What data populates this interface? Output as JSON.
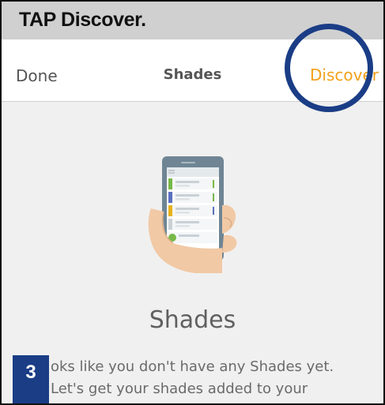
{
  "banner": {
    "instruction": "TAP Discover."
  },
  "navbar": {
    "done_label": "Done",
    "title": "Shades",
    "discover_label": "Discover"
  },
  "empty_state": {
    "illustration": "hand-holding-phone-icon",
    "title": "Shades",
    "message_line1": "oks like you don't have any Shades yet.",
    "message_line2": "Let's get your shades added to your"
  },
  "step": {
    "number": "3"
  },
  "colors": {
    "accent": "#f2a01a",
    "highlight_ring": "#1a3d86",
    "step_badge": "#1a3d86",
    "banner": "#d0d0d0",
    "background": "#f0f0f0"
  }
}
